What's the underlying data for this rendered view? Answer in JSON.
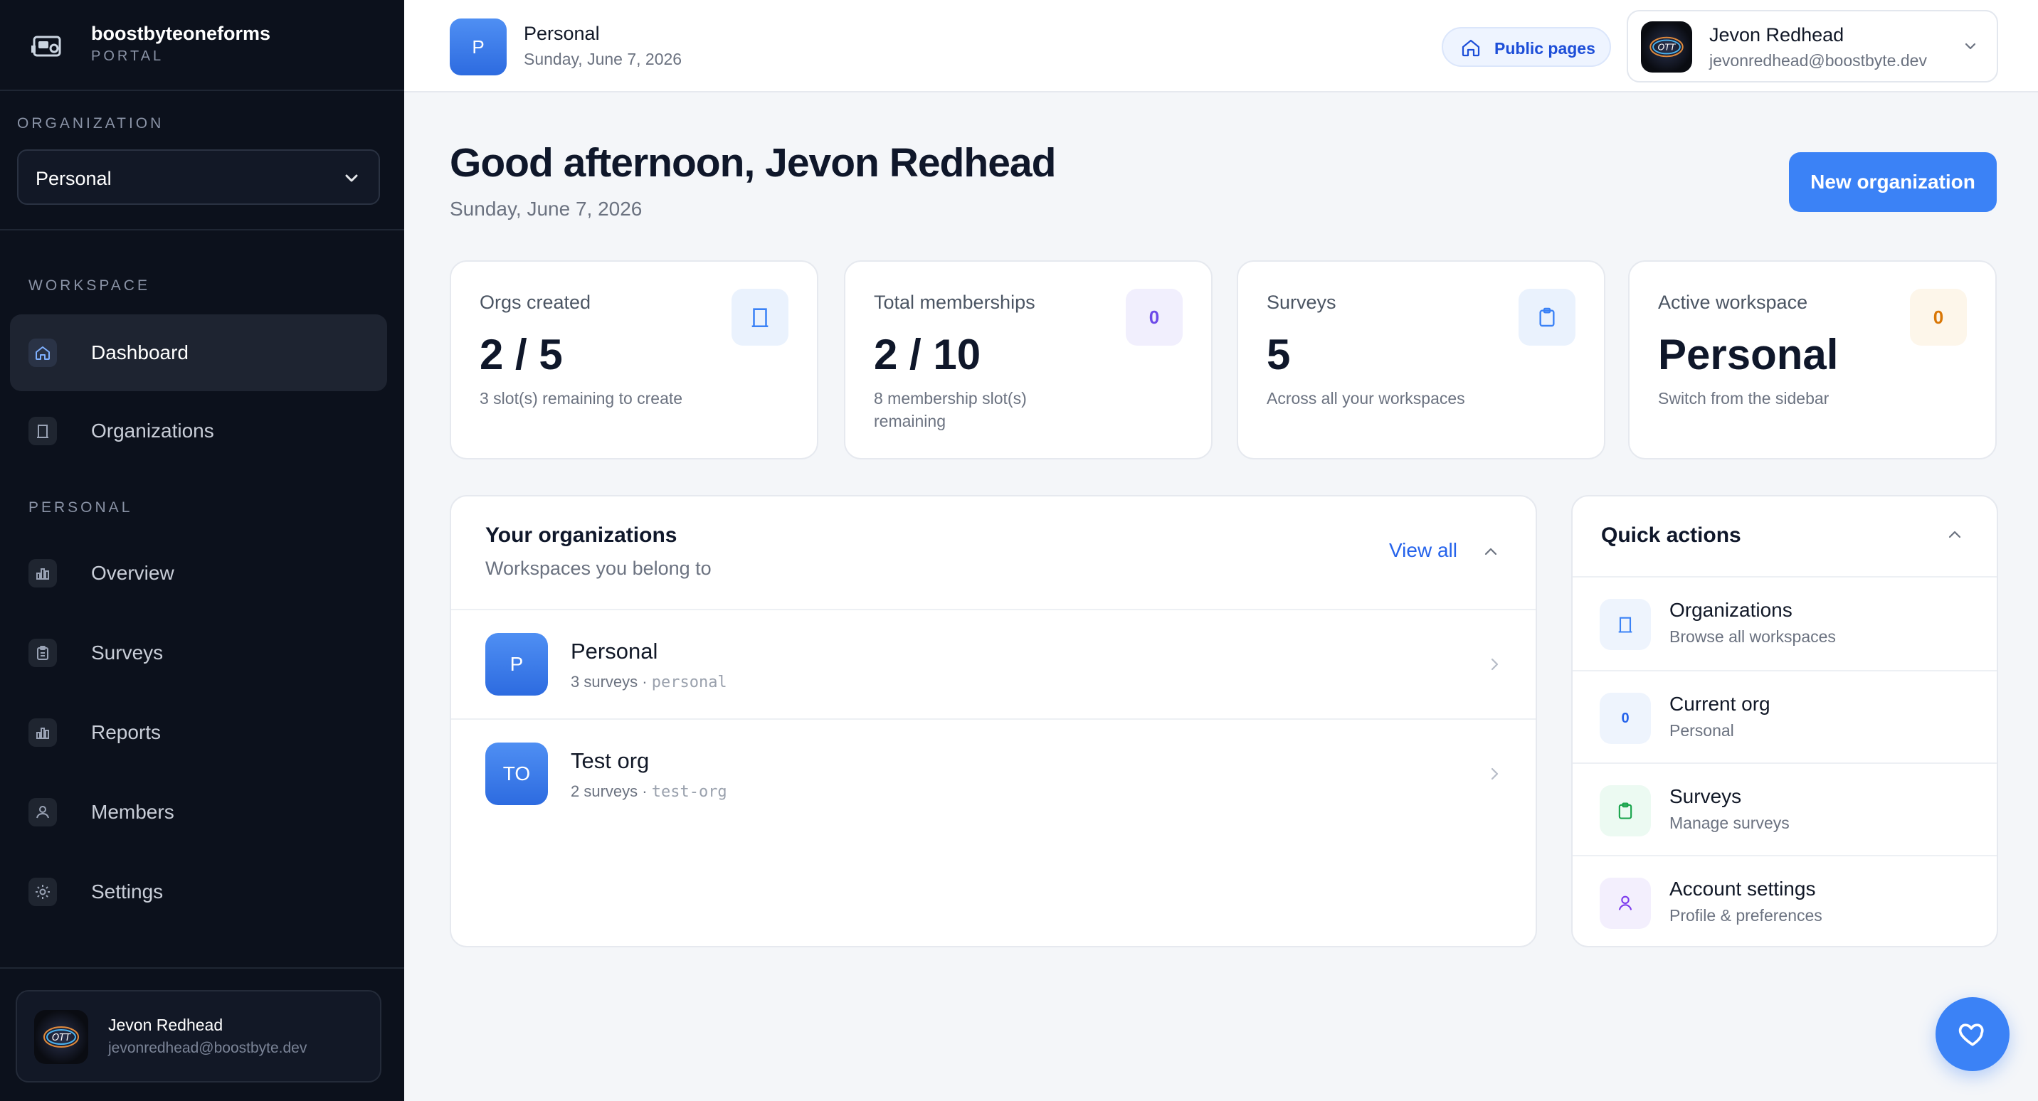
{
  "brand": {
    "name": "boostbyteoneforms",
    "subtitle": "PORTAL"
  },
  "sidebar": {
    "organization_label": "ORGANIZATION",
    "organization_value": "Personal",
    "workspace_label": "WORKSPACE",
    "personal_label": "PERSONAL",
    "items": [
      {
        "label": "Dashboard",
        "icon": "home-icon"
      },
      {
        "label": "Organizations",
        "icon": "building-icon"
      },
      {
        "label": "Overview",
        "icon": "bar-chart-icon"
      },
      {
        "label": "Surveys",
        "icon": "clipboard-icon"
      },
      {
        "label": "Reports",
        "icon": "bar-chart-icon"
      },
      {
        "label": "Members",
        "icon": "users-icon"
      },
      {
        "label": "Settings",
        "icon": "gear-icon"
      }
    ],
    "user": {
      "name": "Jevon Redhead",
      "email": "jevonredhead@boostbyte.dev"
    }
  },
  "topbar": {
    "workspace_initial": "P",
    "workspace_name": "Personal",
    "date": "Sunday, June 7, 2026",
    "public_pages_label": "Public pages",
    "account": {
      "name": "Jevon Redhead",
      "email": "jevonredhead@boostbyte.dev"
    }
  },
  "main": {
    "greeting": "Good afternoon, Jevon Redhead",
    "date": "Sunday, June 7, 2026",
    "new_org_label": "New organization",
    "stats": [
      {
        "label": "Orgs created",
        "value": "2 / 5",
        "sub": "3 slot(s) remaining to create",
        "icon": "building-icon"
      },
      {
        "label": "Total memberships",
        "value": "2 / 10",
        "sub": "8 membership slot(s) remaining",
        "icon_text": "0"
      },
      {
        "label": "Surveys",
        "value": "5",
        "sub": "Across all your workspaces",
        "icon": "clipboard-icon"
      },
      {
        "label": "Active workspace",
        "value": "Personal",
        "sub": "Switch from the sidebar",
        "icon_text": "0"
      }
    ],
    "orgs": {
      "title": "Your organizations",
      "subtitle": "Workspaces you belong to",
      "view_all": "View all",
      "rows": [
        {
          "initials": "P",
          "name": "Personal",
          "count": "3 surveys",
          "sep": " · ",
          "slug": "personal"
        },
        {
          "initials": "TO",
          "name": "Test org",
          "count": "2 surveys",
          "sep": " · ",
          "slug": "test-org"
        }
      ]
    },
    "quick_actions": {
      "title": "Quick actions",
      "items": [
        {
          "title": "Organizations",
          "sub": "Browse all workspaces",
          "icon": "building-icon"
        },
        {
          "title": "Current org",
          "sub": "Personal",
          "icon_text": "0"
        },
        {
          "title": "Surveys",
          "sub": "Manage surveys",
          "icon": "clipboard-icon"
        },
        {
          "title": "Account settings",
          "sub": "Profile & preferences",
          "icon": "user-icon"
        }
      ]
    }
  },
  "colors": {
    "accent": "#3b82f6",
    "sidebar_bg": "#0c111c",
    "page_bg": "#f4f6f9"
  }
}
